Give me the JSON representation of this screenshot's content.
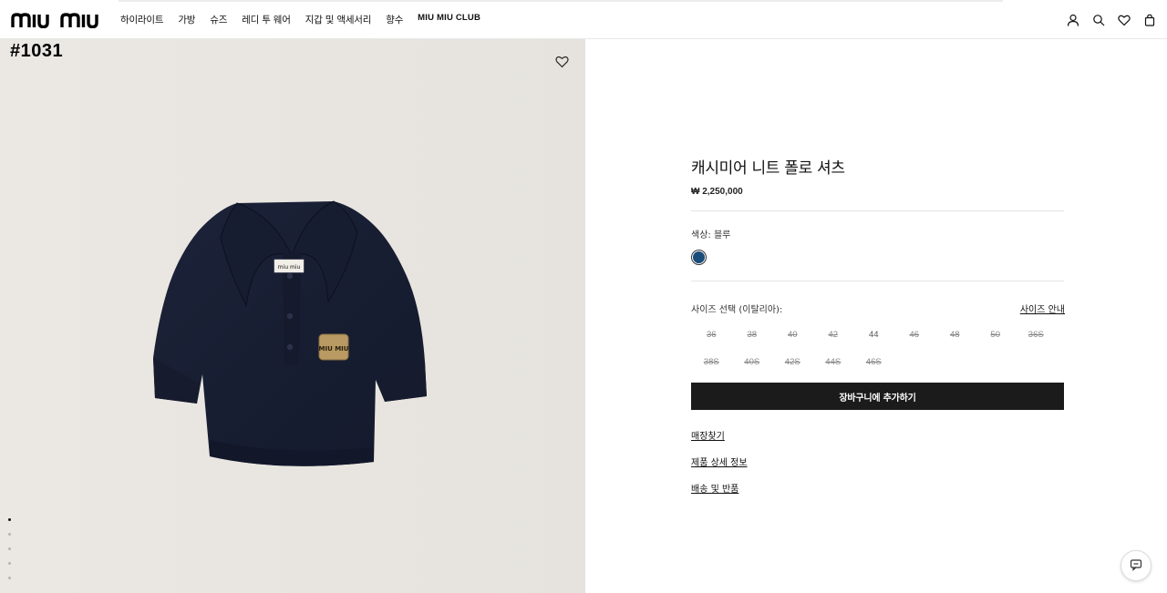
{
  "brand": {
    "logo_text": "miu miu"
  },
  "nav": {
    "items": [
      "하이라이트",
      "가방",
      "슈즈",
      "레디 투 웨어",
      "지갑 및 액세서리",
      "향수",
      "MIU MIU CLUB"
    ]
  },
  "header_icons": [
    "user-icon",
    "search-icon",
    "heart-icon",
    "bag-icon"
  ],
  "gallery": {
    "product_code": "#1031",
    "label_text": "miu miu",
    "patch_text": "MIU MIU",
    "slide_count": 5,
    "active_slide": 1
  },
  "product": {
    "title": "캐시미어 니트 폴로 셔츠",
    "price": "₩ 2,250,000",
    "color_label": "색상:",
    "color_value": "블루",
    "color_hex": "#1a4d7a",
    "size_label": "사이즈 선택 (이탈리아):",
    "size_guide": "사이즈 안내",
    "sizes": [
      {
        "label": "36",
        "available": false
      },
      {
        "label": "38",
        "available": false
      },
      {
        "label": "40",
        "available": false
      },
      {
        "label": "42",
        "available": false
      },
      {
        "label": "44",
        "available": true
      },
      {
        "label": "46",
        "available": false
      },
      {
        "label": "48",
        "available": false
      },
      {
        "label": "50",
        "available": false
      },
      {
        "label": "36S",
        "available": false
      },
      {
        "label": "38S",
        "available": false
      },
      {
        "label": "40S",
        "available": false
      },
      {
        "label": "42S",
        "available": false
      },
      {
        "label": "44S",
        "available": false
      },
      {
        "label": "46S",
        "available": false
      }
    ],
    "add_to_cart": "장바구니에 추가하기",
    "links": [
      "매장찾기",
      "제품 상세 정보",
      "배송 및 반품"
    ]
  },
  "chat": {
    "icon": "chat-icon"
  }
}
